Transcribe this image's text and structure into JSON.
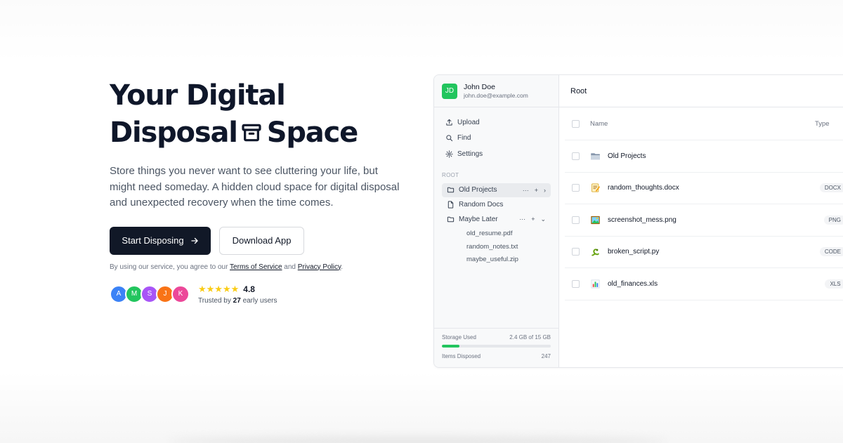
{
  "hero": {
    "title_line1": "Your Digital",
    "title_line2_a": "Disposal",
    "title_line2_b": "Space",
    "title_icon": "archive-icon",
    "description": "Store things you never want to see cluttering your life, but might need someday. A hidden cloud space for digital disposal and unexpected recovery when the time comes.",
    "primary_button": "Start Disposing",
    "primary_button_icon": "arrow-right-icon",
    "secondary_button": "Download App",
    "terms_prefix": "By using our service, you agree to our",
    "terms_link": "Terms of Service",
    "terms_and": "and",
    "privacy_link": "Privacy Policy",
    "terms_suffix": ".",
    "avatars": [
      {
        "letter": "A",
        "color": "#3b82f6"
      },
      {
        "letter": "M",
        "color": "#22c55e"
      },
      {
        "letter": "S",
        "color": "#a855f7"
      },
      {
        "letter": "J",
        "color": "#f97316"
      },
      {
        "letter": "K",
        "color": "#ec4899"
      }
    ],
    "stars": "★★★★★",
    "rating": "4.8",
    "trusted_prefix": "Trusted by",
    "trusted_count": "27",
    "trusted_suffix": "early users"
  },
  "app": {
    "user": {
      "initials": "JD",
      "name": "John Doe",
      "email": "john.doe@example.com",
      "color": "#22c55e"
    },
    "nav": [
      {
        "label": "Upload",
        "icon": "upload-icon"
      },
      {
        "label": "Find",
        "icon": "search-icon"
      },
      {
        "label": "Settings",
        "icon": "gear-icon"
      }
    ],
    "section_label": "ROOT",
    "tree": {
      "old_projects": "Old Projects",
      "random_docs": "Random Docs",
      "maybe_later": "Maybe Later",
      "children": [
        "old_resume.pdf",
        "random_notes.txt",
        "maybe_useful.zip"
      ]
    },
    "storage": {
      "label": "Storage Used",
      "value": "2.4 GB of 15 GB",
      "fraction": 0.16,
      "items_label": "Items Disposed",
      "items_value": "247"
    },
    "main": {
      "breadcrumb": "Root",
      "col_name": "Name",
      "col_type": "Type",
      "rows": [
        {
          "name": "Old Projects",
          "type": "",
          "icon": "folder-icon"
        },
        {
          "name": "random_thoughts.docx",
          "type": "DOCX",
          "icon": "memo-icon"
        },
        {
          "name": "screenshot_mess.png",
          "type": "PNG",
          "icon": "picture-icon"
        },
        {
          "name": "broken_script.py",
          "type": "CODE",
          "icon": "snake-icon"
        },
        {
          "name": "old_finances.xls",
          "type": "XLS",
          "icon": "bar-chart-icon"
        }
      ]
    }
  }
}
